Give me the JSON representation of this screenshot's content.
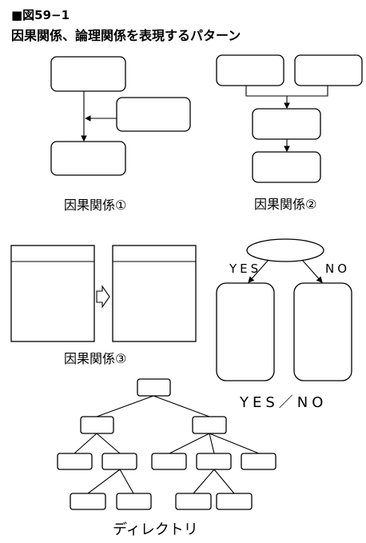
{
  "figure_label": "■図59−1",
  "title": "因果関係、論理関係を表現するパターン",
  "captions": {
    "cause1": "因果関係①",
    "cause2": "因果関係②",
    "cause3": "因果関係③",
    "yes_no": "YES／NO",
    "directory": "ディレクトリ"
  },
  "branch_labels": {
    "yes": "YES",
    "no": "NO"
  }
}
